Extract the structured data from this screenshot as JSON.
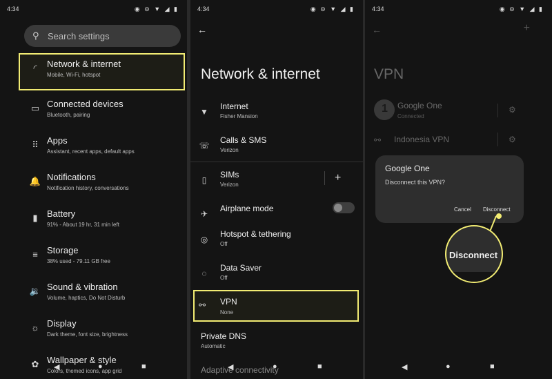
{
  "status": {
    "time": "4:34",
    "icons": "◉ ⊝ ▼ ◢ ▮"
  },
  "panel1": {
    "search_placeholder": "Search settings",
    "items": [
      {
        "icon": "wifi-icon",
        "glyph": "◜",
        "title": "Network & internet",
        "sub": "Mobile, Wi‑Fi, hotspot"
      },
      {
        "icon": "devices-icon",
        "glyph": "▭",
        "title": "Connected devices",
        "sub": "Bluetooth, pairing"
      },
      {
        "icon": "apps-icon",
        "glyph": "⠿",
        "title": "Apps",
        "sub": "Assistant, recent apps, default apps"
      },
      {
        "icon": "bell-icon",
        "glyph": "🔔",
        "title": "Notifications",
        "sub": "Notification history, conversations"
      },
      {
        "icon": "battery-icon",
        "glyph": "▮",
        "title": "Battery",
        "sub": "91% - About 19 hr, 31 min left"
      },
      {
        "icon": "storage-icon",
        "glyph": "≡",
        "title": "Storage",
        "sub": "38% used - 79.11 GB free"
      },
      {
        "icon": "sound-icon",
        "glyph": "🔉",
        "title": "Sound & vibration",
        "sub": "Volume, haptics, Do Not Disturb"
      },
      {
        "icon": "display-icon",
        "glyph": "☼",
        "title": "Display",
        "sub": "Dark theme, font size, brightness"
      },
      {
        "icon": "palette-icon",
        "glyph": "✿",
        "title": "Wallpaper & style",
        "sub": "Colors, themed icons, app grid"
      }
    ]
  },
  "panel2": {
    "title": "Network & internet",
    "items": [
      {
        "icon": "wifi-icon",
        "glyph": "▼",
        "title": "Internet",
        "sub": "Fisher Mansion"
      },
      {
        "icon": "calls-icon",
        "glyph": "☏",
        "title": "Calls & SMS",
        "sub": "Verizon"
      },
      {
        "icon": "sim-icon",
        "glyph": "▯",
        "title": "SIMs",
        "sub": "Verizon"
      },
      {
        "icon": "airplane-icon",
        "glyph": "✈",
        "title": "Airplane mode",
        "sub": ""
      },
      {
        "icon": "hotspot-icon",
        "glyph": "◎",
        "title": "Hotspot & tethering",
        "sub": "Off"
      },
      {
        "icon": "data-saver-icon",
        "glyph": "◌",
        "title": "Data Saver",
        "sub": "Off"
      },
      {
        "icon": "vpn-icon",
        "glyph": "⚯",
        "title": "VPN",
        "sub": "None"
      }
    ],
    "private_dns": {
      "title": "Private DNS",
      "sub": "Automatic"
    },
    "adaptive": {
      "title": "Adaptive connectivity"
    },
    "plus": "+"
  },
  "panel3": {
    "title": "VPN",
    "plus": "+",
    "vpn1": {
      "avatar": "1",
      "name": "Google One",
      "status": "Connected"
    },
    "vpn2": {
      "name": "Indonesia VPN"
    },
    "dialog": {
      "title": "Google One",
      "message": "Disconnect this VPN?",
      "cancel": "Cancel",
      "disconnect": "Disconnect"
    },
    "callout": "Disconnect"
  },
  "nav": {
    "back": "◀",
    "home": "●",
    "recents": "■"
  }
}
